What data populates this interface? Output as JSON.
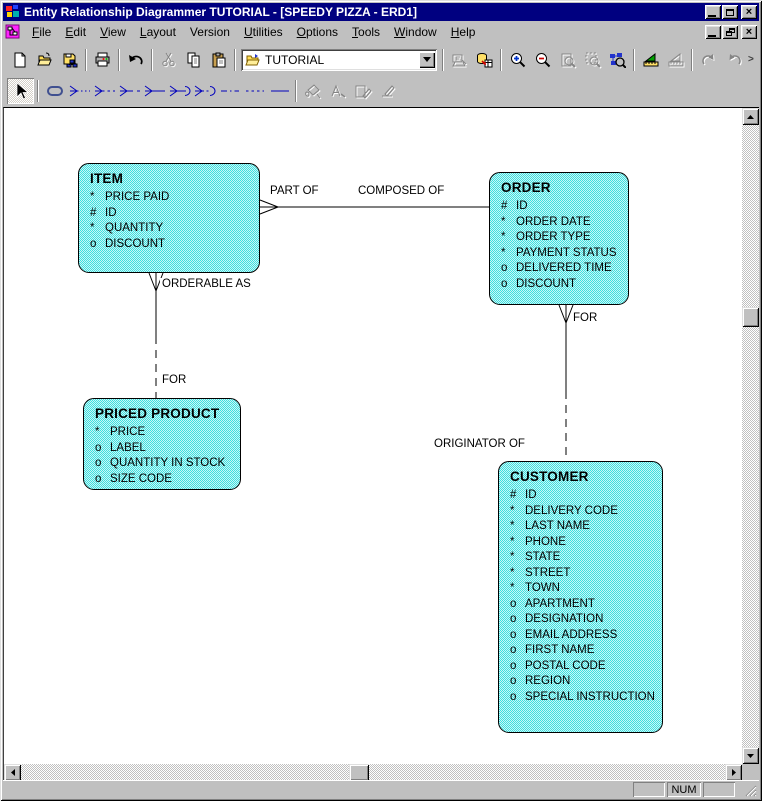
{
  "window": {
    "title": "Entity Relationship Diagrammer TUTORIAL - [SPEEDY PIZZA - ERD1]",
    "controls": {
      "close_glyph": "×"
    }
  },
  "menu": {
    "items": [
      {
        "hot": "F",
        "rest": "ile"
      },
      {
        "hot": "E",
        "rest": "dit"
      },
      {
        "hot": "V",
        "rest": "iew"
      },
      {
        "hot": "L",
        "rest": "ayout"
      },
      {
        "hot": "",
        "rest": "Version"
      },
      {
        "hot": "U",
        "rest": "tilities"
      },
      {
        "hot": "O",
        "rest": "ptions"
      },
      {
        "hot": "T",
        "rest": "ools"
      },
      {
        "hot": "W",
        "rest": "indow"
      },
      {
        "hot": "H",
        "rest": "elp"
      }
    ]
  },
  "toolbar": {
    "context_value": "TUTORIAL",
    "overflow_glyph": ">",
    "buttons": [
      "new",
      "open",
      "save",
      "print",
      "undo",
      "cut",
      "copy",
      "paste",
      "context-selector",
      "update-repository",
      "generate-database",
      "zoom-in",
      "zoom-out",
      "zoom-page",
      "zoom-selection",
      "zoom-overview",
      "autolayout",
      "autolayout-area",
      "layout-undo",
      "layout-redo"
    ]
  },
  "tools": {
    "buttons": [
      "select-pointer",
      "entity-tool",
      "rel-many-dotted",
      "rel-many-dotted-2",
      "rel-many-dash",
      "rel-many-solid",
      "rel-many-arc",
      "rel-many-arc-dotted",
      "rel-dash-dot",
      "rel-dotted",
      "rel-solid",
      "fill-format",
      "font-format",
      "pen-format",
      "line-format"
    ]
  },
  "diagram": {
    "entities": [
      {
        "name": "ITEM",
        "attributes": [
          {
            "marker": "*",
            "name": "PRICE PAID"
          },
          {
            "marker": "#",
            "name": "ID"
          },
          {
            "marker": "*",
            "name": "QUANTITY"
          },
          {
            "marker": "o",
            "name": "DISCOUNT"
          }
        ]
      },
      {
        "name": "ORDER",
        "attributes": [
          {
            "marker": "#",
            "name": "ID"
          },
          {
            "marker": "*",
            "name": "ORDER DATE"
          },
          {
            "marker": "*",
            "name": "ORDER TYPE"
          },
          {
            "marker": "*",
            "name": "PAYMENT STATUS"
          },
          {
            "marker": "o",
            "name": "DELIVERED TIME"
          },
          {
            "marker": "o",
            "name": "DISCOUNT"
          }
        ]
      },
      {
        "name": "PRICED PRODUCT",
        "attributes": [
          {
            "marker": "*",
            "name": "PRICE"
          },
          {
            "marker": "o",
            "name": "LABEL"
          },
          {
            "marker": "o",
            "name": "QUANTITY IN STOCK"
          },
          {
            "marker": "o",
            "name": "SIZE CODE"
          }
        ]
      },
      {
        "name": "CUSTOMER",
        "attributes": [
          {
            "marker": "#",
            "name": "ID"
          },
          {
            "marker": "*",
            "name": "DELIVERY CODE"
          },
          {
            "marker": "*",
            "name": "LAST NAME"
          },
          {
            "marker": "*",
            "name": "PHONE"
          },
          {
            "marker": "*",
            "name": "STATE"
          },
          {
            "marker": "*",
            "name": "STREET"
          },
          {
            "marker": "*",
            "name": "TOWN"
          },
          {
            "marker": "o",
            "name": "APARTMENT"
          },
          {
            "marker": "o",
            "name": "DESIGNATION"
          },
          {
            "marker": "o",
            "name": "EMAIL ADDRESS"
          },
          {
            "marker": "o",
            "name": "FIRST NAME"
          },
          {
            "marker": "o",
            "name": "POSTAL CODE"
          },
          {
            "marker": "o",
            "name": "REGION"
          },
          {
            "marker": "o",
            "name": "SPECIAL INSTRUCTION"
          }
        ]
      }
    ],
    "relationships": [
      {
        "between": "ITEM-ORDER",
        "from_label": "PART OF",
        "to_label": "COMPOSED OF"
      },
      {
        "between": "ITEM-PRICED PRODUCT",
        "from_label": "ORDERABLE AS",
        "to_label": "FOR"
      },
      {
        "between": "ORDER-CUSTOMER",
        "from_label": "FOR",
        "to_label": "ORIGINATOR OF"
      }
    ]
  },
  "statusbar": {
    "num": "NUM"
  },
  "colors": {
    "titlebar": "#000080",
    "chrome": "#c0c0c0",
    "entity_fill": "#7feeee",
    "entity_border": "#000000",
    "tool_blue": "#0000bd",
    "canvas": "#ffffff"
  }
}
